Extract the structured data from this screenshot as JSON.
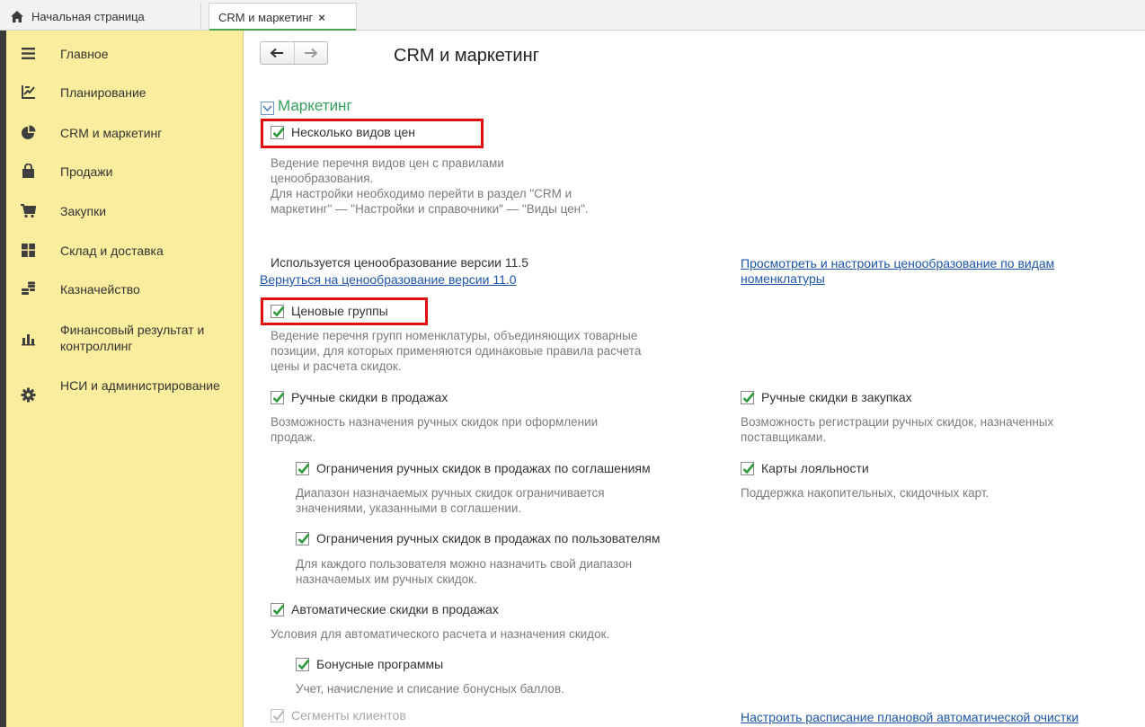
{
  "tabs": {
    "home_label": "Начальная страница",
    "active_label": "CRM и маркетинг",
    "close_glyph": "×"
  },
  "sidebar": {
    "items": [
      {
        "label": "Главное",
        "icon": "menu-icon"
      },
      {
        "label": "Планирование",
        "icon": "planning-icon"
      },
      {
        "label": "CRM и маркетинг",
        "icon": "pie-chart-icon"
      },
      {
        "label": "Продажи",
        "icon": "shopping-bag-icon"
      },
      {
        "label": "Закупки",
        "icon": "cart-icon"
      },
      {
        "label": "Склад и доставка",
        "icon": "warehouse-icon"
      },
      {
        "label": "Казначейство",
        "icon": "coins-icon"
      },
      {
        "label": "Финансовый результат и контроллинг",
        "icon": "bar-chart-icon"
      },
      {
        "label": "НСИ и администрирование",
        "icon": "gear-icon"
      }
    ]
  },
  "main": {
    "title": "CRM и маркетинг",
    "group_title": "Маркетинг",
    "price_types": {
      "label": "Несколько видов цен",
      "desc": [
        "Ведение перечня видов цен с правилами",
        "ценообразования.",
        "Для настройки необходимо перейти в раздел \"CRM и",
        "маркетинг\" — \"Настройки и справочники\" — \"Виды цен\"."
      ]
    },
    "pricing_version": {
      "text": "Используется ценообразование версии 11.5",
      "revert_link": "Вернуться на ценообразование версии 11.0",
      "configure_link": [
        "Просмотреть и настроить ценообразование по видам",
        "номенклатуры"
      ]
    },
    "price_groups": {
      "label": "Ценовые группы",
      "desc": [
        "Ведение перечня групп номенклатуры, объединяющих товарные",
        "позиции, для которых применяются одинаковые правила расчета",
        "цены и расчета скидок."
      ]
    },
    "manual_sales": {
      "label": "Ручные скидки в продажах",
      "desc": [
        "Возможность назначения ручных скидок при оформлении",
        "продаж."
      ]
    },
    "manual_purchases": {
      "label": "Ручные скидки в закупках",
      "desc": [
        "Возможность регистрации ручных скидок, назначенных",
        "поставщиками."
      ]
    },
    "limit_agreements": {
      "label": "Ограничения ручных скидок в продажах по соглашениям",
      "desc": [
        "Диапазон назначаемых ручных скидок ограничивается",
        "значениями, указанными в соглашении."
      ]
    },
    "loyalty_cards": {
      "label": "Карты лояльности",
      "desc": [
        "Поддержка накопительных, скидочных карт."
      ]
    },
    "limit_users": {
      "label": "Ограничения ручных скидок в продажах по пользователям",
      "desc": [
        "Для каждого пользователя можно назначить свой диапазон",
        "назначаемых им ручных скидок."
      ]
    },
    "auto_discounts": {
      "label": "Автоматические скидки в продажах",
      "desc": [
        "Условия для автоматического расчета и назначения скидок."
      ]
    },
    "bonus_programs": {
      "label": "Бонусные программы",
      "desc": [
        "Учет, начисление и списание бонусных баллов."
      ]
    },
    "client_segments": {
      "label": "Сегменты клиентов"
    },
    "schedule_link": "Настроить расписание плановой автоматической очистки"
  },
  "colors": {
    "sidebar_bg": "#fbed9e",
    "check_green": "#2f9a3a",
    "group_title_green": "#33a05a",
    "highlight_red": "#e01010",
    "link_blue": "#1c55a8"
  }
}
